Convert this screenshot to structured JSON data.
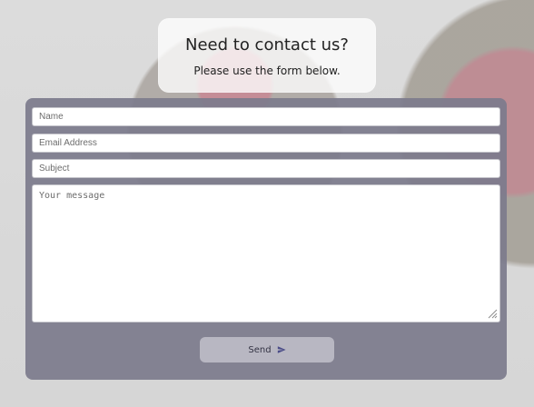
{
  "header": {
    "title": "Need to contact us?",
    "subtitle": "Please use the form below."
  },
  "form": {
    "name_placeholder": "Name",
    "email_placeholder": "Email Address",
    "subject_placeholder": "Subject",
    "message_placeholder": "Your message",
    "send_label": "Send"
  },
  "icons": {
    "send": "paper-plane-icon",
    "resize": "resize-grip-icon"
  },
  "colors": {
    "panel": "#7C7B8C",
    "header_card": "#FFFFFF",
    "button": "#BFBEC8",
    "text": "#222222"
  }
}
